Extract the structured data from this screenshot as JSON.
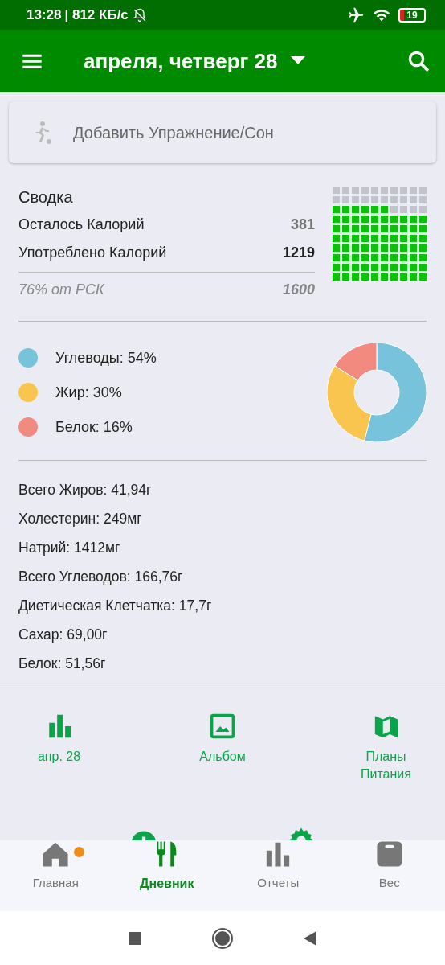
{
  "status_bar": {
    "time": "13:28",
    "speed": "| 812 КБ/с",
    "battery": "19"
  },
  "app_bar": {
    "title": "апреля, четверг 28"
  },
  "add_exercise": {
    "placeholder": "Добавить Упражнение/Сон"
  },
  "summary": {
    "title": "Сводка",
    "rows": [
      {
        "label": "Осталось Калорий",
        "value": "381",
        "kind": "plain"
      },
      {
        "label": "Употреблено Калорий",
        "value": "1219",
        "kind": "bold"
      },
      {
        "label": "76% от РСК",
        "value": "1600",
        "kind": "italic"
      }
    ]
  },
  "macros": [
    {
      "label": "Углеводы: 54%",
      "color": "#77c3dc"
    },
    {
      "label": "Жир: 30%",
      "color": "#f9c54e"
    },
    {
      "label": "Белок: 16%",
      "color": "#f38a80"
    }
  ],
  "macro_chart": {
    "chart_data": {
      "type": "donut",
      "values": [
        54,
        30,
        16
      ]
    }
  },
  "nutrients": [
    "Всего Жиров: 41,94г",
    "Холестерин: 249мг",
    "Натрий: 1412мг",
    "Всего Углеводов: 166,76г",
    "Диетическая Клетчатка: 17,7г",
    "Сахар: 69,00г",
    "Белок: 51,56г"
  ],
  "shortcuts": [
    {
      "label": "апр. 28",
      "kind": "chart"
    },
    {
      "label": "Альбом",
      "kind": "image"
    },
    {
      "label": "Планы Питания",
      "kind": "map"
    }
  ],
  "bottom_nav": [
    {
      "label": "Главная",
      "kind": "home",
      "selected": false,
      "badge": true
    },
    {
      "label": "Дневник",
      "kind": "diary",
      "selected": true,
      "badge": false
    },
    {
      "label": "Отчеты",
      "kind": "reports",
      "selected": false,
      "badge": false
    },
    {
      "label": "Вес",
      "kind": "weight",
      "selected": false,
      "badge": false
    }
  ]
}
